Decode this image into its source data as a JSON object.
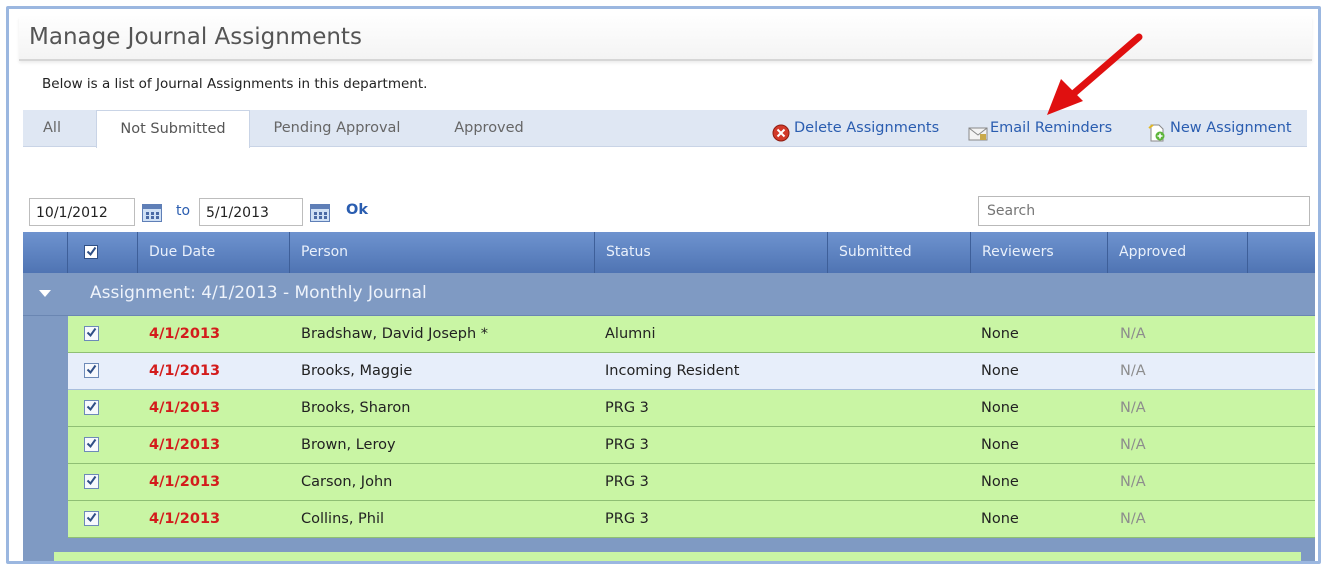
{
  "page": {
    "title": "Manage Journal Assignments",
    "description": "Below is a list of Journal Assignments in this department."
  },
  "tabs": [
    {
      "label": "All"
    },
    {
      "label": "Not Submitted",
      "active": true
    },
    {
      "label": "Pending Approval"
    },
    {
      "label": "Approved"
    }
  ],
  "actions": {
    "delete_label": "Delete Assignments",
    "email_label": "Email Reminders",
    "new_label": "New Assignment"
  },
  "filter": {
    "from_date": "10/1/2012",
    "to_label": "to",
    "to_date": "5/1/2013",
    "ok_label": "Ok",
    "search_placeholder": "Search"
  },
  "grid": {
    "columns": [
      "Due Date",
      "Person",
      "Status",
      "Submitted",
      "Reviewers",
      "Approved"
    ],
    "group_title": "Assignment: 4/1/2013 - Monthly Journal",
    "rows": [
      {
        "due": "4/1/2013",
        "person": "Bradshaw, David Joseph *",
        "status": "Alumni",
        "submitted": "",
        "reviewers": "None",
        "approved": "N/A"
      },
      {
        "due": "4/1/2013",
        "person": "Brooks, Maggie",
        "status": "Incoming Resident",
        "submitted": "",
        "reviewers": "None",
        "approved": "N/A"
      },
      {
        "due": "4/1/2013",
        "person": "Brooks, Sharon",
        "status": "PRG 3",
        "submitted": "",
        "reviewers": "None",
        "approved": "N/A"
      },
      {
        "due": "4/1/2013",
        "person": "Brown, Leroy",
        "status": "PRG 3",
        "submitted": "",
        "reviewers": "None",
        "approved": "N/A"
      },
      {
        "due": "4/1/2013",
        "person": "Carson, John",
        "status": "PRG 3",
        "submitted": "",
        "reviewers": "None",
        "approved": "N/A"
      },
      {
        "due": "4/1/2013",
        "person": "Collins, Phil",
        "status": "PRG 3",
        "submitted": "",
        "reviewers": "None",
        "approved": "N/A"
      }
    ]
  },
  "colors": {
    "header_blue": "#4f74b3",
    "row_green": "#c9f5a4",
    "row_selected": "#e7eefa",
    "date_red": "#d31c1c",
    "link_blue": "#2a5db0",
    "annotation_arrow": "#e01010"
  },
  "icons": {
    "delete": "delete-circle-icon",
    "email": "envelope-icon",
    "new": "new-document-icon",
    "calendar": "calendar-icon",
    "expand": "caret-down-icon"
  }
}
